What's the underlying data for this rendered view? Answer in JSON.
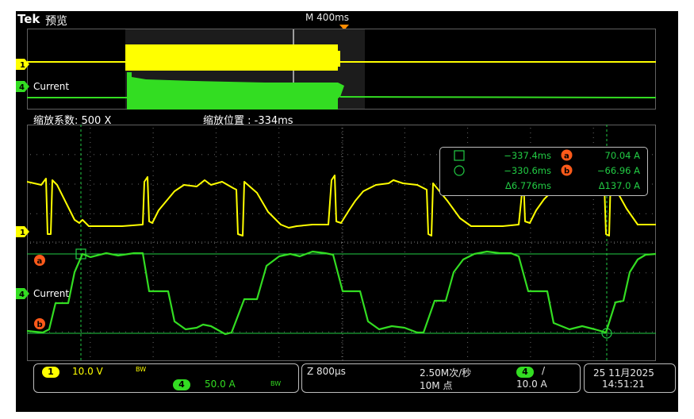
{
  "header": {
    "brand": "Tek",
    "mode_label": "预览",
    "record_length": "M 400ms"
  },
  "overview": {
    "ch1_marker": "1",
    "ch4_marker": "4",
    "ch4_label": "Current",
    "zoom_factor": "缩放系数: 500 X",
    "zoom_position": "缩放位置 :  -334ms"
  },
  "zoom_window": {
    "ch1_marker": "1",
    "ch4_marker": "4",
    "ch4_label": "Current",
    "cursor_a_marker": "a",
    "cursor_b_marker": "b"
  },
  "cursor_readout": {
    "row1_time": "−337.4ms",
    "row1_marker": "a",
    "row1_value": "70.04 A",
    "row2_time": "−330.6ms",
    "row2_marker": "b",
    "row2_value": "−66.96 A",
    "delta_time": "Δ6.776ms",
    "delta_value": "Δ137.0 A"
  },
  "status": {
    "ch1_badge": "1",
    "ch1_scale": "10.0 V",
    "ch1_bw": "BW",
    "ch4_badge": "4",
    "ch4_scale": "50.0 A",
    "ch4_bw": "BW",
    "zoom_scale": "Z 800μs",
    "sample_rate": "2.50M次/秒",
    "record_points": "10M 点",
    "trigger_source": "4",
    "trigger_slope": "/",
    "trigger_level": "10.0 A",
    "date": "25 11月2025",
    "time": "14:51:21"
  },
  "colors": {
    "ch1": "#ffff00",
    "ch4": "#33dd22",
    "cursor": "#ff5a1a",
    "screen_bg": "#000000"
  }
}
